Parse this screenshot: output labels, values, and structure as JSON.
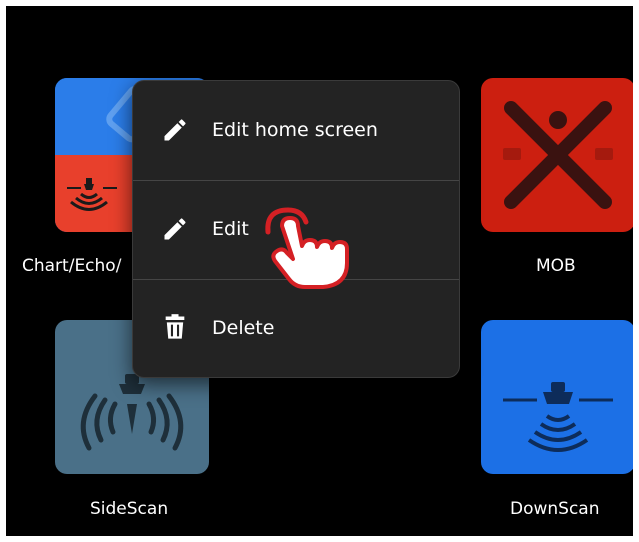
{
  "tiles": [
    {
      "label": "Chart/Echo/"
    },
    {
      "label": "MOB"
    },
    {
      "label": "SideScan"
    },
    {
      "label": "DownScan"
    }
  ],
  "context_menu": {
    "items": [
      {
        "label": "Edit home screen",
        "icon": "pencil-icon"
      },
      {
        "label": "Edit",
        "icon": "pencil-icon"
      },
      {
        "label": "Delete",
        "icon": "trash-icon"
      }
    ]
  },
  "colors": {
    "chart_blue": "#2b7de9",
    "echo_red": "#e8402c",
    "mob_red": "#cc1f10",
    "sidescan_steel": "#4a7088",
    "downscan_blue": "#1c70e6",
    "menu_bg": "#232323",
    "pointer_red": "#d42024"
  },
  "pointer": {
    "icon": "hand-pointer-icon"
  }
}
